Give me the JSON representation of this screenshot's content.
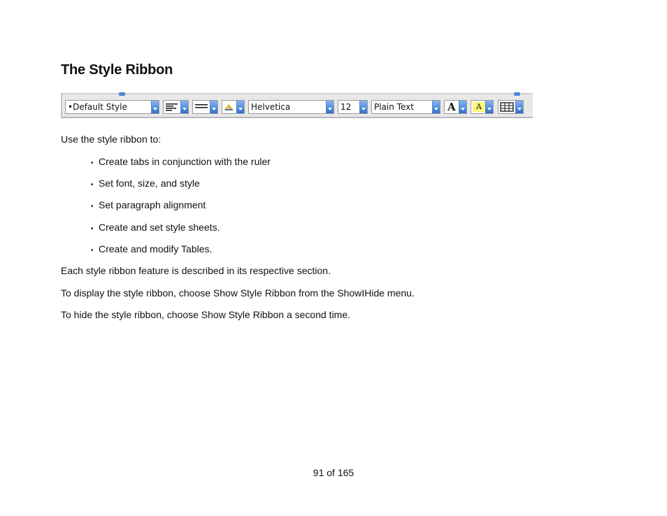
{
  "heading": "The Style Ribbon",
  "ribbon": {
    "style_value": "•Default Style",
    "font_value": "Helvetica",
    "size_value": "12",
    "text_style_value": "Plain Text",
    "icons": {
      "alignment": "align-left-icon",
      "spacing": "line-spacing-icon",
      "text_color": "text-color-icon",
      "font_color": "font-color-A-icon",
      "highlight": "highlight-A-icon",
      "table": "table-icon"
    },
    "colors": {
      "arrow_top": "#86b6f0",
      "arrow_bottom": "#2f6fd0",
      "highlight": "#fff57a"
    },
    "font_color_glyph": "A",
    "highlight_glyph": "A"
  },
  "intro": "Use the style ribbon to:",
  "bullets": [
    "Create tabs in conjunction with the ruler",
    "Set font, size, and style",
    "Set paragraph alignment",
    "Create and set style sheets.",
    "Create and modify Tables."
  ],
  "bullet_symbol": "•",
  "para_feature": "Each style ribbon feature is described in its respective section.",
  "para_display": "To display the style ribbon, choose Show Style Ribbon from the ShowIHide menu.",
  "para_hide": "To hide the style ribbon, choose Show Style Ribbon a second time.",
  "page_number": "91 of 165"
}
